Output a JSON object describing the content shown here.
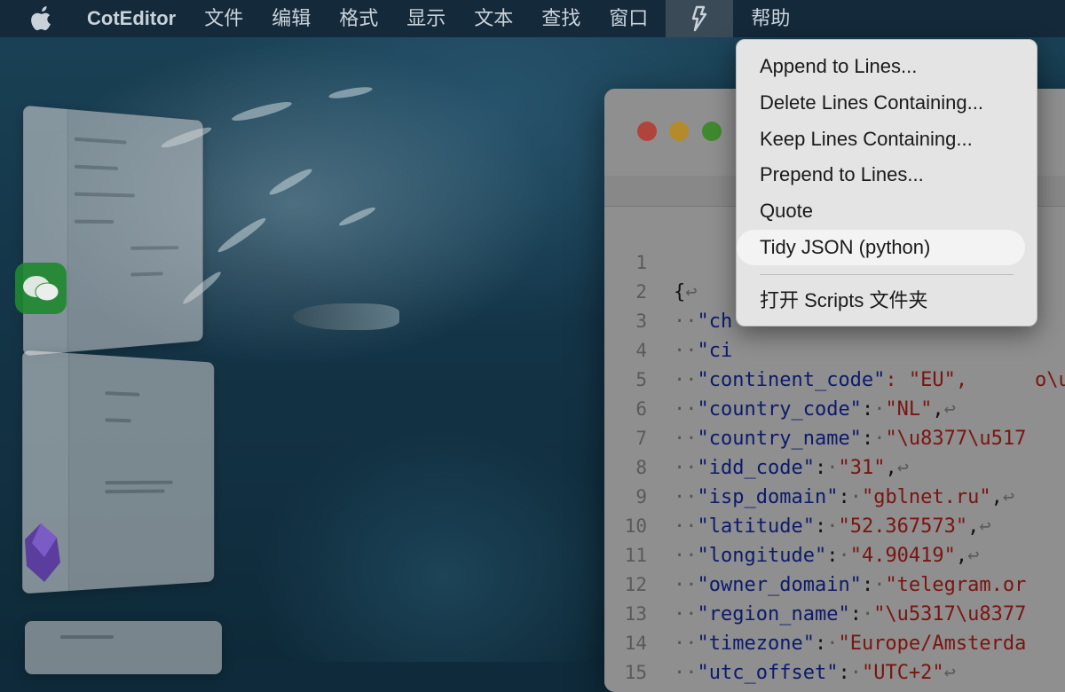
{
  "menubar": {
    "app_name": "CotEditor",
    "menus": [
      "文件",
      "编辑",
      "格式",
      "显示",
      "文本",
      "查找",
      "窗口"
    ],
    "help": "帮助"
  },
  "script_menu": {
    "items": [
      "Append to Lines...",
      "Delete Lines Containing...",
      "Keep Lines Containing...",
      "Prepend to Lines...",
      "Quote",
      "Tidy JSON (python)"
    ],
    "highlighted_index": 5,
    "open_folder": "打开 Scripts 文件夹"
  },
  "editor": {
    "line_numbers": [
      "1",
      "2",
      "3",
      "4",
      "5",
      "6",
      "7",
      "8",
      "9",
      "10",
      "11",
      "12",
      "13",
      "14",
      "15"
    ],
    "lines": [
      {
        "open": "{"
      },
      {
        "key": "\"ch",
        "rest": ""
      },
      {
        "key": "\"ci",
        "rest": ""
      },
      {
        "key": "\"continent_code\"",
        "rest": ": \"EU\","
      },
      {
        "key": "\"country_code\"",
        "sep": ":",
        "val": "\"NL\"",
        "end": ","
      },
      {
        "key": "\"country_name\"",
        "sep": ":",
        "val": "\"\\u8377\\u517",
        "end": ""
      },
      {
        "key": "\"idd_code\"",
        "sep": ":",
        "val": "\"31\"",
        "end": ","
      },
      {
        "key": "\"isp_domain\"",
        "sep": ":",
        "val": "\"gblnet.ru\"",
        "end": ","
      },
      {
        "key": "\"latitude\"",
        "sep": ":",
        "val": "\"52.367573\"",
        "end": ","
      },
      {
        "key": "\"longitude\"",
        "sep": ":",
        "val": "\"4.90419\"",
        "end": ","
      },
      {
        "key": "\"owner_domain\"",
        "sep": ":",
        "val": "\"telegram.or",
        "end": ""
      },
      {
        "key": "\"region_name\"",
        "sep": ":",
        "val": "\"\\u5317\\u8377",
        "end": ""
      },
      {
        "key": "\"timezone\"",
        "sep": ":",
        "val": "\"Europe/Amsterda",
        "end": ""
      },
      {
        "key": "\"utc_offset\"",
        "sep": ":",
        "val": "\"UTC+2\"",
        "end": ""
      },
      {
        "close": "}"
      }
    ],
    "line3_tail": "o\\u",
    "return_glyph": "↩",
    "indent_glyph": "··",
    "space_glyph": "·"
  },
  "colors": {
    "menubar_bg": "#14293a",
    "menu_bg": "#e4e4e4",
    "highlight_bg": "#f3f3f3",
    "traffic_red": "#b0443b",
    "traffic_yellow": "#b58a2a",
    "traffic_green": "#3f8a2e"
  }
}
